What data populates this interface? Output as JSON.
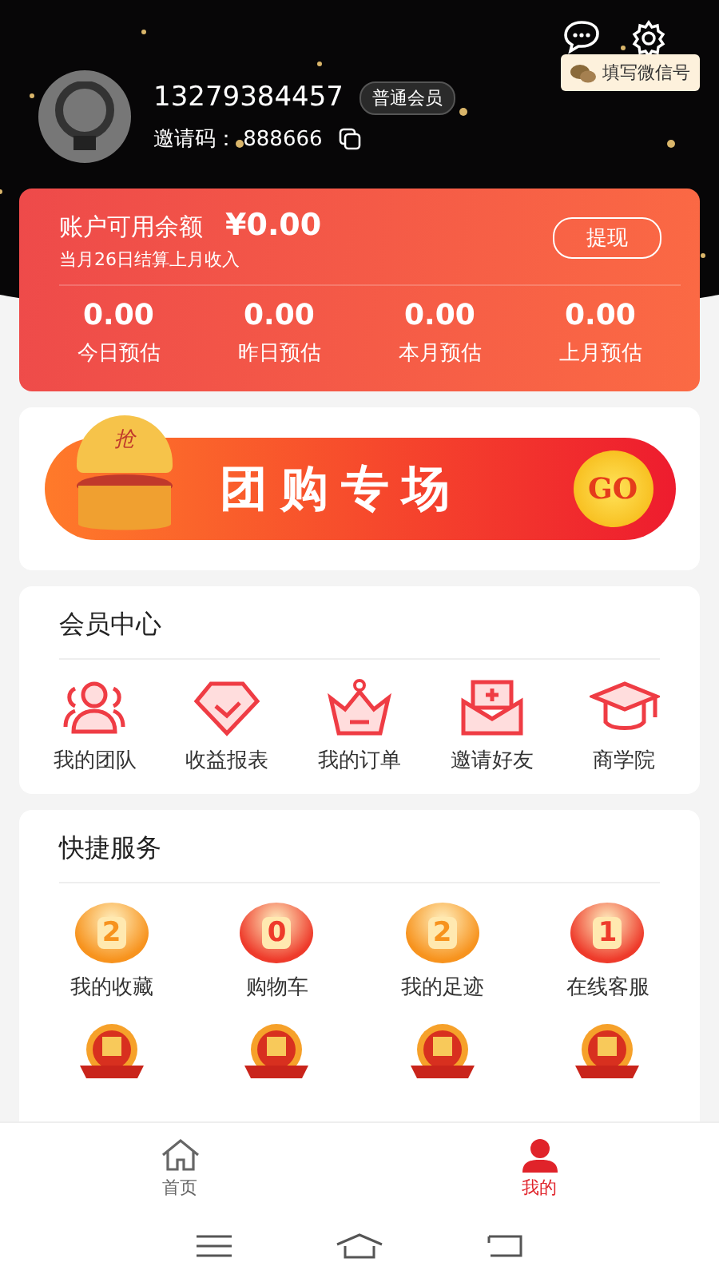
{
  "profile": {
    "phone": "13279384457",
    "level_badge": "普通会员",
    "invite_label": "邀请码：",
    "invite_code": "888666",
    "wechat_button": "填写微信号"
  },
  "balance": {
    "label": "账户可用余额",
    "currency": "¥",
    "amount": "0.00",
    "note": "当月26日结算上月收入",
    "withdraw_button": "提现",
    "stats": [
      {
        "value": "0.00",
        "label": "今日预估"
      },
      {
        "value": "0.00",
        "label": "昨日预估"
      },
      {
        "value": "0.00",
        "label": "本月预估"
      },
      {
        "value": "0.00",
        "label": "上月预估"
      }
    ]
  },
  "banner": {
    "title": "团购专场",
    "go": "GO",
    "gift_mark": "抢"
  },
  "member_center": {
    "title": "会员中心",
    "items": [
      {
        "kind": "team",
        "label": "我的团队"
      },
      {
        "kind": "report",
        "label": "收益报表"
      },
      {
        "kind": "order",
        "label": "我的订单"
      },
      {
        "kind": "invite",
        "label": "邀请好友"
      },
      {
        "kind": "school",
        "label": "商学院"
      }
    ]
  },
  "quick_services": {
    "title": "快捷服务",
    "items": [
      {
        "kind": "number",
        "badge": "2",
        "label": "我的收藏",
        "color": "#f7931e"
      },
      {
        "kind": "number",
        "badge": "0",
        "label": "购物车",
        "color": "#ee3b2b"
      },
      {
        "kind": "number",
        "badge": "2",
        "label": "我的足迹",
        "color": "#f7931e"
      },
      {
        "kind": "number",
        "badge": "1",
        "label": "在线客服",
        "color": "#ee3b2b"
      },
      {
        "kind": "medal"
      },
      {
        "kind": "medal"
      },
      {
        "kind": "medal"
      },
      {
        "kind": "medal"
      }
    ]
  },
  "tab_bar": [
    {
      "kind": "home",
      "label": "首页",
      "selected": false
    },
    {
      "kind": "me",
      "label": "我的",
      "selected": true
    }
  ]
}
